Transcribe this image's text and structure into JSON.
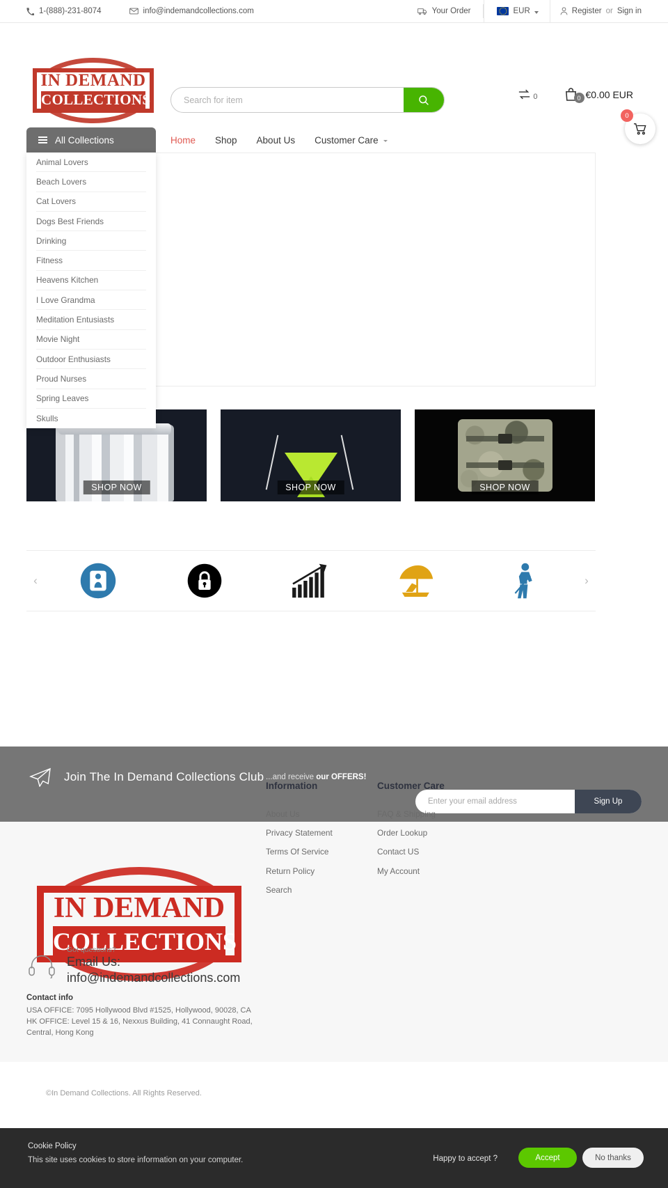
{
  "topbar": {
    "phone": "1-(888)-231-8074",
    "email": "info@indemandcollections.com",
    "order": "Your Order",
    "currency": "EUR",
    "register": "Register",
    "or": "or",
    "signin": "Sign in"
  },
  "brand": {
    "line1": "IN DEMAND",
    "line2": "COLLECTIONS"
  },
  "search": {
    "placeholder": "Search for item",
    "value": ""
  },
  "header": {
    "compare_count": "0",
    "bag_count": "0",
    "cart_total": "€0.00 EUR",
    "float_cart_count": "0"
  },
  "nav": {
    "all_collections": "All Collections",
    "items": [
      {
        "label": "Home",
        "active": true
      },
      {
        "label": "Shop",
        "active": false
      },
      {
        "label": "About Us",
        "active": false
      },
      {
        "label": "Customer Care",
        "active": false
      }
    ]
  },
  "collections": [
    "Animal Lovers",
    "Beach Lovers",
    "Cat Lovers",
    "Dogs Best Friends",
    "Drinking",
    "Fitness",
    "Heavens Kitchen",
    "I Love Grandma",
    "Meditation Entusiasts",
    "Movie Night",
    "Outdoor Enthusiasts",
    "Proud Nurses",
    "Spring Leaves",
    "Skulls"
  ],
  "banners": [
    {
      "cta": "SHOP NOW",
      "kind": "shaker-set"
    },
    {
      "cta": "SHOP NOW",
      "kind": "green-jigger"
    },
    {
      "cta": "SHOP NOW",
      "kind": "camo-backpack"
    }
  ],
  "carousel": {
    "prev": "‹",
    "next": "›",
    "items": [
      {
        "name": "scale-person-icon",
        "color": "#2e7aad"
      },
      {
        "name": "lock-icon",
        "color": "#000000"
      },
      {
        "name": "growth-chart-icon",
        "color": "#1a1a1a"
      },
      {
        "name": "beach-chair-icon",
        "color": "#e0a315"
      },
      {
        "name": "golfer-icon",
        "color": "#2e7aad"
      }
    ]
  },
  "newsletter": {
    "title": "Join The In Demand Collections Club",
    "subtitle_plain": "...and receive ",
    "subtitle_bold": "our OFFERS!",
    "placeholder": "Enter your email address",
    "value": "",
    "button": "Sign Up"
  },
  "footer": {
    "columns": [
      {
        "title": "Information",
        "links": [
          "About Us",
          "Privacy Statement",
          "Terms Of Service",
          "Return Policy",
          "Search"
        ]
      },
      {
        "title": "Customer Care",
        "links": [
          "FAQ & Shipping",
          "Order Lookup",
          "Contact US",
          "My Account"
        ]
      }
    ],
    "support": {
      "sub": "Got questions?",
      "label": "Email Us:",
      "email": "info@indemandcollections.com"
    },
    "contact": {
      "title": "Contact info",
      "line1": "USA OFFICE: 7095 Hollywood Blvd #1525, Hollywood, 90028, CA",
      "line2": "HK OFFICE: Level 15 & 16, Nexxus Building, 41 Connaught Road,",
      "line3": "Central, Hong Kong"
    },
    "copyright": "©In Demand Collections. All Rights Reserved."
  },
  "cookie": {
    "title": "Cookie Policy",
    "text": "This site uses cookies to store information on your computer.",
    "question": "Happy to accept ?",
    "accept": "Accept",
    "decline": "No thanks"
  }
}
